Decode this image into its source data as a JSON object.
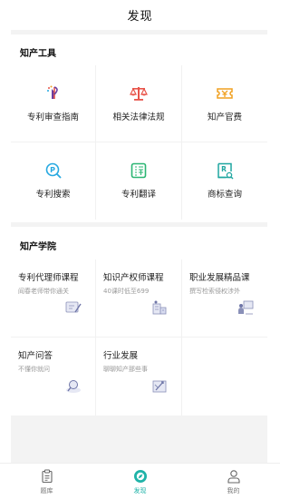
{
  "header": {
    "title": "发现"
  },
  "tools_section": {
    "title": "知产工具",
    "items": [
      {
        "label": "专利审查指南",
        "icon": "patent-guide-icon",
        "color": "#6b3fa0"
      },
      {
        "label": "相关法律法规",
        "icon": "scales-icon",
        "color": "#e8544a"
      },
      {
        "label": "知产官费",
        "icon": "yen-ticket-icon",
        "color": "#f0a020"
      },
      {
        "label": "专利搜索",
        "icon": "patent-search-icon",
        "color": "#27a9e1"
      },
      {
        "label": "专利翻译",
        "icon": "translate-icon",
        "color": "#2bb673"
      },
      {
        "label": "商标查询",
        "icon": "trademark-search-icon",
        "color": "#1fa6a0"
      }
    ]
  },
  "academy_section": {
    "title": "知产学院",
    "courses": [
      {
        "title": "专利代理师课程",
        "subtitle": "阎春老师带你通关"
      },
      {
        "title": "知识产权师课程",
        "subtitle": "40课时低至699"
      },
      {
        "title": "职业发展精品课",
        "subtitle": "撰写检索侵权涉外"
      },
      {
        "title": "知产问答",
        "subtitle": "不懂你就问"
      },
      {
        "title": "行业发展",
        "subtitle": "聊聊知产那些事"
      }
    ]
  },
  "tabbar": {
    "tabs": [
      {
        "label": "题库",
        "icon": "clipboard-icon",
        "active": false
      },
      {
        "label": "发现",
        "icon": "compass-icon",
        "active": true
      },
      {
        "label": "我的",
        "icon": "user-icon",
        "active": false
      }
    ],
    "active_color": "#1fb3a8"
  }
}
